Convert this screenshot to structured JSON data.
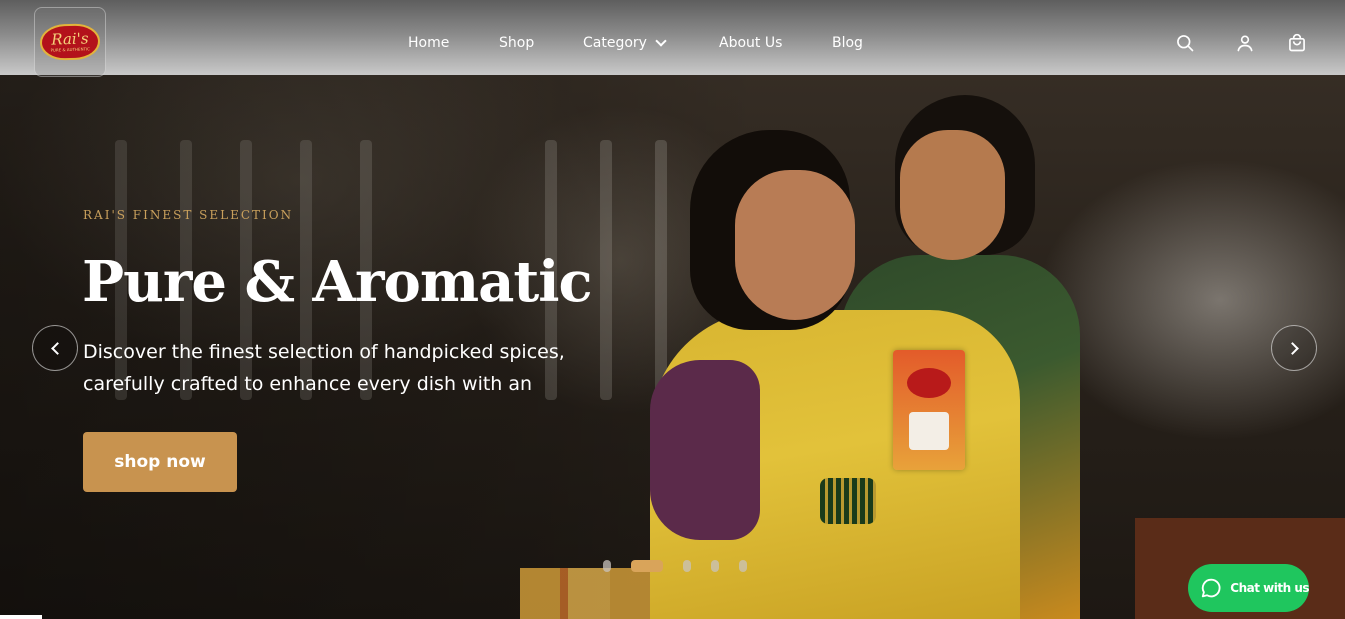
{
  "header": {
    "logo": {
      "text": "Rai's",
      "sub": "PURE & AUTHENTIC"
    },
    "nav": [
      {
        "label": "Home"
      },
      {
        "label": "Shop"
      },
      {
        "label": "Category",
        "has_dropdown": true
      },
      {
        "label": "About Us"
      },
      {
        "label": "Blog"
      }
    ],
    "icons": [
      "search-icon",
      "user-icon",
      "cart-icon"
    ]
  },
  "hero": {
    "eyebrow": "RAI'S FINEST SELECTION",
    "headline": "Pure & Aromatic",
    "description_lines": [
      "Discover the finest selection of handpicked spices,",
      "carefully crafted to enhance every dish with an"
    ],
    "cta_label": "shop now",
    "prev_icon": "chevron-left-icon",
    "next_icon": "chevron-right-icon"
  },
  "carousel": {
    "slide_count": 5,
    "active_index": 1
  },
  "chat": {
    "label": "Chat with us",
    "icon": "chat-bubble-icon"
  },
  "colors": {
    "accent": "#c8934f",
    "eyebrow": "#c9a05c",
    "chat": "#1fc65e",
    "active_dot": "#d9a45a"
  }
}
